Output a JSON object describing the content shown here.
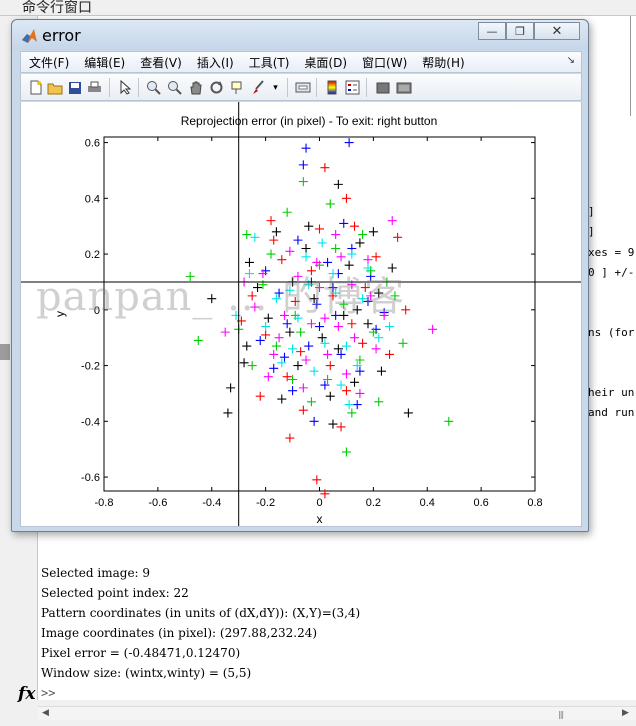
{
  "desktop": {
    "command_window_title": "命令行窗口",
    "right_fragments": [
      "]",
      "]",
      "xes = 9",
      "0 ] +/-",
      "ns (for",
      "heir un",
      "and run"
    ],
    "output_lines": [
      "Selected image: 9",
      "Selected point index: 22",
      "Pattern coordinates (in units of (dX,dY)): (X,Y)=(3,4)",
      "Image coordinates (in pixel): (297.88,232.24)",
      "Pixel error = (-0.48471,0.12470)",
      "Window size: (wintx,winty) = (5,5)"
    ],
    "fx_label": "fx",
    "prompt": ">>"
  },
  "figure": {
    "title": "error",
    "window_buttons": {
      "minimize": "—",
      "restore": "❐",
      "close": "✕"
    },
    "menu": [
      "文件(F)",
      "编辑(E)",
      "查看(V)",
      "插入(I)",
      "工具(T)",
      "桌面(D)",
      "窗口(W)",
      "帮助(H)"
    ],
    "toolbar_icons": [
      "new-figure-icon",
      "open-icon",
      "save-icon",
      "print-icon",
      "pointer-icon",
      "zoom-in-icon",
      "zoom-out-icon",
      "pan-icon",
      "rotate-icon",
      "data-cursor-icon",
      "brush-icon",
      "link-icon",
      "colorbar-icon",
      "legend-icon",
      "hide-tools-icon",
      "show-tools-icon"
    ]
  },
  "watermark": "panpan_ ... 的博客",
  "chart_data": {
    "type": "scatter",
    "title": "Reprojection error (in pixel) - To exit: right button",
    "xlabel": "x",
    "ylabel": "y",
    "xlim": [
      -0.8,
      0.8
    ],
    "ylim": [
      -0.65,
      0.62
    ],
    "xticks": [
      "-0.8",
      "-0.6",
      "-0.4",
      "-0.2",
      "0",
      "0.2",
      "0.4",
      "0.6",
      "0.8"
    ],
    "yticks": [
      "0.6",
      "0.4",
      "0.2",
      "0",
      "-0.2",
      "-0.4",
      "-0.6"
    ],
    "marker": "+",
    "grid": false,
    "crosshair": {
      "x": -0.3,
      "y": 0.1
    },
    "series": [
      {
        "color": "#0000ff",
        "values": [
          [
            -0.05,
            0.58
          ],
          [
            0.11,
            0.6
          ],
          [
            -0.06,
            0.52
          ],
          [
            -0.03,
            0.1
          ],
          [
            0.05,
            0.08
          ],
          [
            0.18,
            0.03
          ],
          [
            -0.12,
            -0.05
          ],
          [
            0.08,
            -0.16
          ],
          [
            -0.17,
            -0.21
          ],
          [
            0.02,
            -0.27
          ],
          [
            0.12,
            0.22
          ],
          [
            -0.2,
            0.14
          ],
          [
            0.14,
            -0.34
          ],
          [
            -0.02,
            -0.4
          ],
          [
            0.21,
            -0.07
          ],
          [
            -0.08,
            0.25
          ],
          [
            0.06,
            -0.02
          ],
          [
            -0.15,
            0.06
          ],
          [
            0.03,
            0.17
          ],
          [
            -0.04,
            -0.13
          ],
          [
            0.19,
            0.12
          ],
          [
            -0.1,
            -0.29
          ],
          [
            0.09,
            0.31
          ],
          [
            0.0,
            -0.06
          ],
          [
            -0.22,
            -0.11
          ],
          [
            0.15,
            -0.22
          ],
          [
            -0.01,
            0.02
          ],
          [
            0.07,
            0.13
          ],
          [
            -0.13,
            -0.17
          ],
          [
            0.24,
            -0.01
          ]
        ]
      },
      {
        "color": "#ff0000",
        "values": [
          [
            0.02,
            0.51
          ],
          [
            -0.01,
            -0.61
          ],
          [
            0.02,
            -0.66
          ],
          [
            -0.11,
            -0.46
          ],
          [
            -0.22,
            -0.31
          ],
          [
            0.1,
            0.4
          ],
          [
            0.29,
            0.26
          ],
          [
            -0.18,
            0.32
          ],
          [
            0.16,
            -0.12
          ],
          [
            -0.09,
            0.03
          ],
          [
            0.04,
            -0.2
          ],
          [
            -0.25,
            0.05
          ],
          [
            0.21,
            0.19
          ],
          [
            -0.06,
            -0.36
          ],
          [
            0.12,
            -0.05
          ],
          [
            -0.14,
            0.18
          ],
          [
            0.0,
            0.29
          ],
          [
            0.08,
            -0.42
          ],
          [
            -0.2,
            -0.09
          ],
          [
            0.17,
            0.08
          ],
          [
            -0.03,
            0.14
          ],
          [
            0.26,
            -0.16
          ],
          [
            -0.12,
            -0.24
          ],
          [
            0.05,
            0.05
          ],
          [
            0.32,
            0.0
          ],
          [
            -0.29,
            -0.04
          ],
          [
            0.13,
            0.3
          ],
          [
            -0.07,
            -0.15
          ],
          [
            0.1,
            -0.29
          ],
          [
            -0.17,
            0.25
          ]
        ]
      },
      {
        "color": "#00cc00",
        "values": [
          [
            0.48,
            -0.4
          ],
          [
            -0.48,
            0.12
          ],
          [
            -0.45,
            -0.11
          ],
          [
            -0.06,
            0.46
          ],
          [
            0.1,
            -0.51
          ],
          [
            0.22,
            -0.33
          ],
          [
            -0.27,
            0.27
          ],
          [
            0.19,
            0.14
          ],
          [
            -0.16,
            -0.13
          ],
          [
            0.06,
            0.22
          ],
          [
            -0.09,
            -0.02
          ],
          [
            0.15,
            -0.18
          ],
          [
            -0.21,
            0.09
          ],
          [
            0.03,
            -0.25
          ],
          [
            0.28,
            0.05
          ],
          [
            -0.12,
            0.35
          ],
          [
            0.09,
            0.02
          ],
          [
            -0.03,
            -0.33
          ],
          [
            0.2,
            -0.08
          ],
          [
            -0.25,
            -0.2
          ],
          [
            0.0,
            0.16
          ],
          [
            0.12,
            -0.37
          ],
          [
            -0.18,
            0.2
          ],
          [
            0.25,
            0.1
          ],
          [
            -0.07,
            -0.08
          ],
          [
            0.04,
            0.38
          ],
          [
            -0.3,
            -0.07
          ],
          [
            0.16,
            0.27
          ],
          [
            -0.1,
            -0.25
          ],
          [
            0.31,
            -0.12
          ]
        ]
      },
      {
        "color": "#000000",
        "values": [
          [
            0.33,
            -0.37
          ],
          [
            -0.34,
            -0.37
          ],
          [
            -0.28,
            -0.19
          ],
          [
            -0.33,
            -0.28
          ],
          [
            0.05,
            -0.41
          ],
          [
            0.07,
            0.45
          ],
          [
            -0.26,
            0.17
          ],
          [
            0.2,
            0.28
          ],
          [
            -0.1,
            0.1
          ],
          [
            0.14,
            0.0
          ],
          [
            -0.19,
            -0.03
          ],
          [
            0.01,
            -0.1
          ],
          [
            -0.05,
            0.22
          ],
          [
            0.23,
            -0.22
          ],
          [
            -0.14,
            -0.32
          ],
          [
            0.11,
            0.16
          ],
          [
            -0.23,
            0.08
          ],
          [
            0.07,
            -0.14
          ],
          [
            0.18,
            -0.05
          ],
          [
            -0.02,
            0.04
          ],
          [
            0.27,
            0.15
          ],
          [
            -0.16,
            0.28
          ],
          [
            0.04,
            -0.31
          ],
          [
            -0.08,
            -0.2
          ],
          [
            0.15,
            0.24
          ],
          [
            -0.27,
            -0.13
          ],
          [
            0.09,
            -0.02
          ],
          [
            -0.04,
            0.3
          ],
          [
            0.22,
            0.06
          ],
          [
            -0.11,
            -0.08
          ],
          [
            -0.4,
            0.04
          ],
          [
            0.13,
            -0.26
          ]
        ]
      },
      {
        "color": "#ff00ff",
        "values": [
          [
            0.42,
            -0.07
          ],
          [
            0.27,
            0.32
          ],
          [
            -0.35,
            -0.08
          ],
          [
            -0.01,
            0.17
          ],
          [
            0.07,
            -0.06
          ],
          [
            -0.15,
            -0.1
          ],
          [
            0.18,
            0.18
          ],
          [
            -0.06,
            -0.28
          ],
          [
            0.12,
            0.09
          ],
          [
            -0.24,
            0.01
          ],
          [
            0.03,
            -0.16
          ],
          [
            -0.11,
            0.21
          ],
          [
            0.21,
            -0.14
          ],
          [
            -0.19,
            -0.24
          ],
          [
            0.06,
            0.27
          ],
          [
            -0.03,
            -0.05
          ],
          [
            0.15,
            -0.3
          ],
          [
            -0.21,
            0.13
          ],
          [
            0.0,
            0.08
          ],
          [
            0.24,
            -0.02
          ],
          [
            -0.08,
            0.12
          ],
          [
            0.1,
            -0.23
          ],
          [
            -0.13,
            -0.02
          ],
          [
            0.19,
            0.05
          ],
          [
            -0.05,
            -0.18
          ],
          [
            0.08,
            0.19
          ],
          [
            -0.17,
            -0.16
          ],
          [
            0.13,
            -0.1
          ],
          [
            -0.28,
            0.1
          ],
          [
            0.02,
            -0.03
          ]
        ]
      },
      {
        "color": "#00e5e5",
        "values": [
          [
            -0.24,
            0.26
          ],
          [
            0.02,
            -0.12
          ],
          [
            -0.11,
            0.07
          ],
          [
            0.1,
            -0.13
          ],
          [
            -0.05,
            0.19
          ],
          [
            0.16,
            0.04
          ],
          [
            -0.2,
            -0.06
          ],
          [
            0.05,
            0.13
          ],
          [
            -0.14,
            -0.19
          ],
          [
            0.22,
            -0.1
          ],
          [
            -0.02,
            -0.22
          ],
          [
            0.12,
            0.2
          ],
          [
            -0.26,
            0.13
          ],
          [
            0.08,
            -0.27
          ],
          [
            -0.08,
            -0.03
          ],
          [
            0.18,
            0.15
          ],
          [
            -0.16,
            0.04
          ],
          [
            0.01,
            0.24
          ],
          [
            0.14,
            -0.2
          ],
          [
            -0.31,
            -0.02
          ],
          [
            0.06,
            0.06
          ],
          [
            -0.1,
            -0.14
          ],
          [
            0.26,
            -0.06
          ],
          [
            -0.04,
            0.09
          ],
          [
            0.11,
            -0.34
          ]
        ]
      }
    ]
  }
}
